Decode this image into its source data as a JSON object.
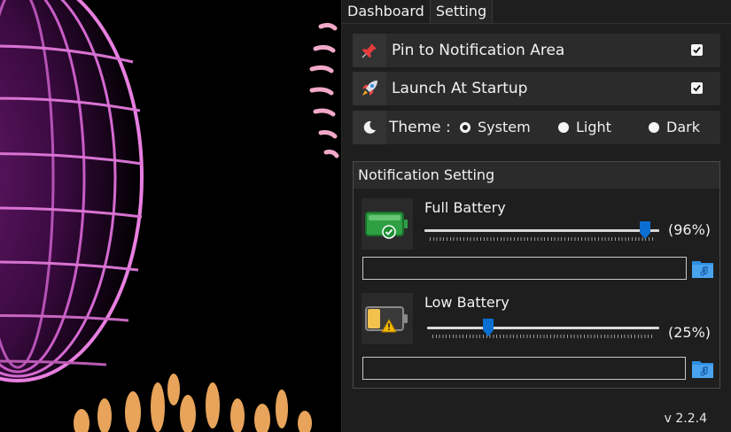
{
  "tabs": [
    {
      "label": "Dashboard"
    },
    {
      "label": "Setting"
    }
  ],
  "settings": {
    "pin": {
      "label": "Pin to Notification Area",
      "checked": true,
      "icon": "pushpin-icon"
    },
    "startup": {
      "label": "Launch At Startup",
      "checked": true,
      "icon": "rocket-icon"
    },
    "theme": {
      "label": "Theme :",
      "icon": "moon-icon",
      "options": [
        "System",
        "Light",
        "Dark"
      ],
      "selected": "System"
    }
  },
  "notification": {
    "title": "Notification Setting",
    "full": {
      "label": "Full Battery",
      "percent_text": "(96%)",
      "value": 96,
      "sound_path": ""
    },
    "low": {
      "label": "Low Battery",
      "percent_text": "(25%)",
      "value": 25,
      "sound_path": ""
    }
  },
  "version": "v 2.2.4",
  "colors": {
    "accent": "#0a6fd1",
    "panel": "#1e1e1e",
    "row": "#2b2b2b",
    "folder": "#2d8fe0"
  }
}
